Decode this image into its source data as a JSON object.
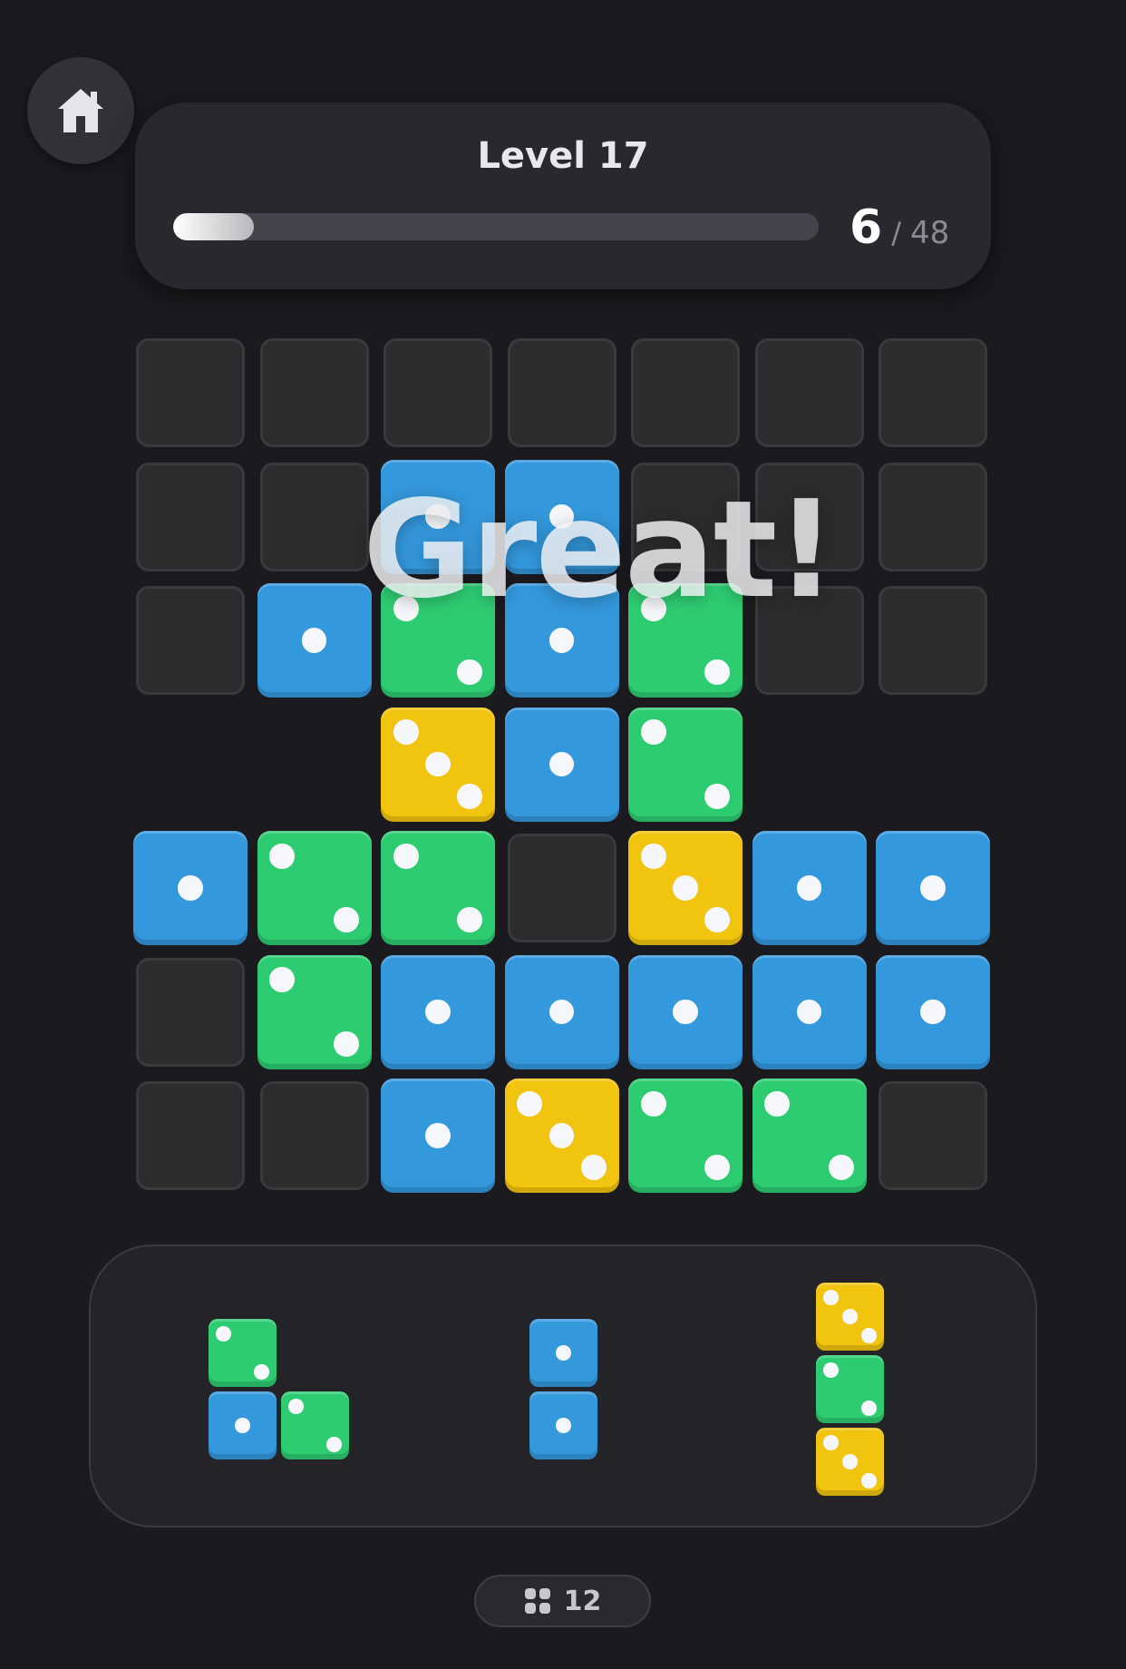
{
  "header": {
    "level_label": "Level 17",
    "progress": {
      "current": "6",
      "separator": "/",
      "total": "48",
      "fraction": 0.125
    }
  },
  "home_icon": "home-icon",
  "banner": {
    "text": "Great!"
  },
  "colors": {
    "blue": "#3498dc",
    "green": "#2ecc71",
    "yellow": "#f1c40f",
    "slot": "#2c2c2e",
    "background": "#1b1b1f"
  },
  "board": {
    "rows": 7,
    "cols": 7,
    "cells": [
      [
        "empty",
        "empty",
        "empty",
        "empty",
        "empty",
        "empty",
        "empty"
      ],
      [
        "empty",
        "empty",
        "blue-1",
        "blue-1",
        "empty",
        "empty",
        "empty"
      ],
      [
        "empty",
        "blue-1",
        "green-2",
        "blue-1",
        "green-2",
        "empty",
        "empty"
      ],
      [
        "none",
        "none",
        "yellow-3",
        "blue-1",
        "green-2",
        "none",
        "none"
      ],
      [
        "blue-1",
        "green-2",
        "green-2",
        "empty",
        "yellow-3",
        "blue-1",
        "blue-1"
      ],
      [
        "empty",
        "green-2",
        "blue-1",
        "blue-1",
        "blue-1",
        "blue-1",
        "blue-1"
      ],
      [
        "empty",
        "empty",
        "blue-1",
        "yellow-3",
        "green-2",
        "green-2",
        "empty"
      ]
    ]
  },
  "pieces": [
    {
      "cells": [
        {
          "r": 0,
          "c": 0,
          "die": "green-2"
        },
        {
          "r": 1,
          "c": 0,
          "die": "blue-1"
        },
        {
          "r": 1,
          "c": 1,
          "die": "green-2"
        }
      ]
    },
    {
      "cells": [
        {
          "r": 0,
          "c": 0,
          "die": "blue-1"
        },
        {
          "r": 1,
          "c": 0,
          "die": "blue-1"
        }
      ]
    },
    {
      "cells": [
        {
          "r": 0,
          "c": 0,
          "die": "yellow-3"
        },
        {
          "r": 1,
          "c": 0,
          "die": "green-2"
        },
        {
          "r": 2,
          "c": 0,
          "die": "yellow-3"
        }
      ]
    }
  ],
  "moves": {
    "icon": "grid-dots-icon",
    "count": "12"
  }
}
